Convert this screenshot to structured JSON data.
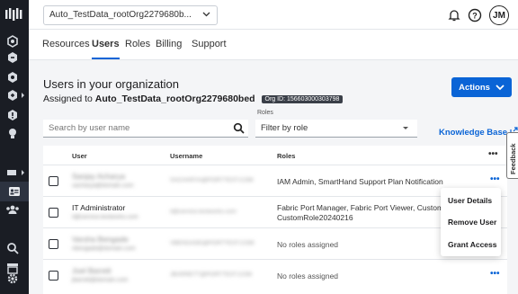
{
  "sidebar": {
    "icons": [
      "logo-icon",
      "cloud-icon",
      "hexagon-icon",
      "hexagon-icon",
      "hexagon-icon",
      "alert-icon",
      "lightbulb-icon",
      "network-icon",
      "id-card-icon",
      "team-icon",
      "search-icon",
      "storefront-icon",
      "gear-icon"
    ]
  },
  "header": {
    "org_selector": "Auto_TestData_rootOrg2279680b...",
    "avatar_initials": "JM"
  },
  "tabs": [
    "Resources",
    "Users",
    "Roles",
    "Billing",
    "Support"
  ],
  "active_tab": "Users",
  "main": {
    "title": "Users in your organization",
    "subtitle_prefix": "Assigned to ",
    "org_name": "Auto_TestData_rootOrg2279680bed",
    "org_id_badge": "Org ID: 156603000303798",
    "actions_label": "Actions",
    "search_placeholder": "Search by user name",
    "roles_label": "Roles",
    "role_filter_value": "Filter by role",
    "knowledge_base": "Knowledge Base"
  },
  "table": {
    "headers": {
      "user": "User",
      "username": "Username",
      "roles": "Roles",
      "more": "•••"
    },
    "rows": [
      {
        "name": "Sanjay Acharya",
        "email": "sacharya@domain.com",
        "login": "SACHARYA@PORTTEST.COM",
        "roles": "IAM Admin, SmartHand Support Plan Notification",
        "blurred": true,
        "more": "•••"
      },
      {
        "name": "IT Administrator",
        "email": "it@service.testworks.com",
        "login": "it@service.testworks.com",
        "roles": "Fabric Port Manager, Fabric Port Viewer, Custom CustomRole20240216",
        "blurred": false,
        "more": "•••"
      },
      {
        "name": "Varsha Bengade",
        "email": "vbengade@domain.com",
        "login": "VBENGADE@PORTTEST.COM",
        "roles": "No roles assigned",
        "blurred": true,
        "more": "•••"
      },
      {
        "name": "Joel Barrett",
        "email": "jbarrett@domain.com",
        "login": "JBARRETT@PORTTEST.COM",
        "roles": "No roles assigned",
        "blurred": true,
        "more": "•••"
      }
    ]
  },
  "context_menu": [
    "User Details",
    "Remove User",
    "Grant Access"
  ],
  "feedback_label": "Feedback",
  "colors": {
    "accent": "#0a64d6",
    "rail": "#1a1d24"
  }
}
